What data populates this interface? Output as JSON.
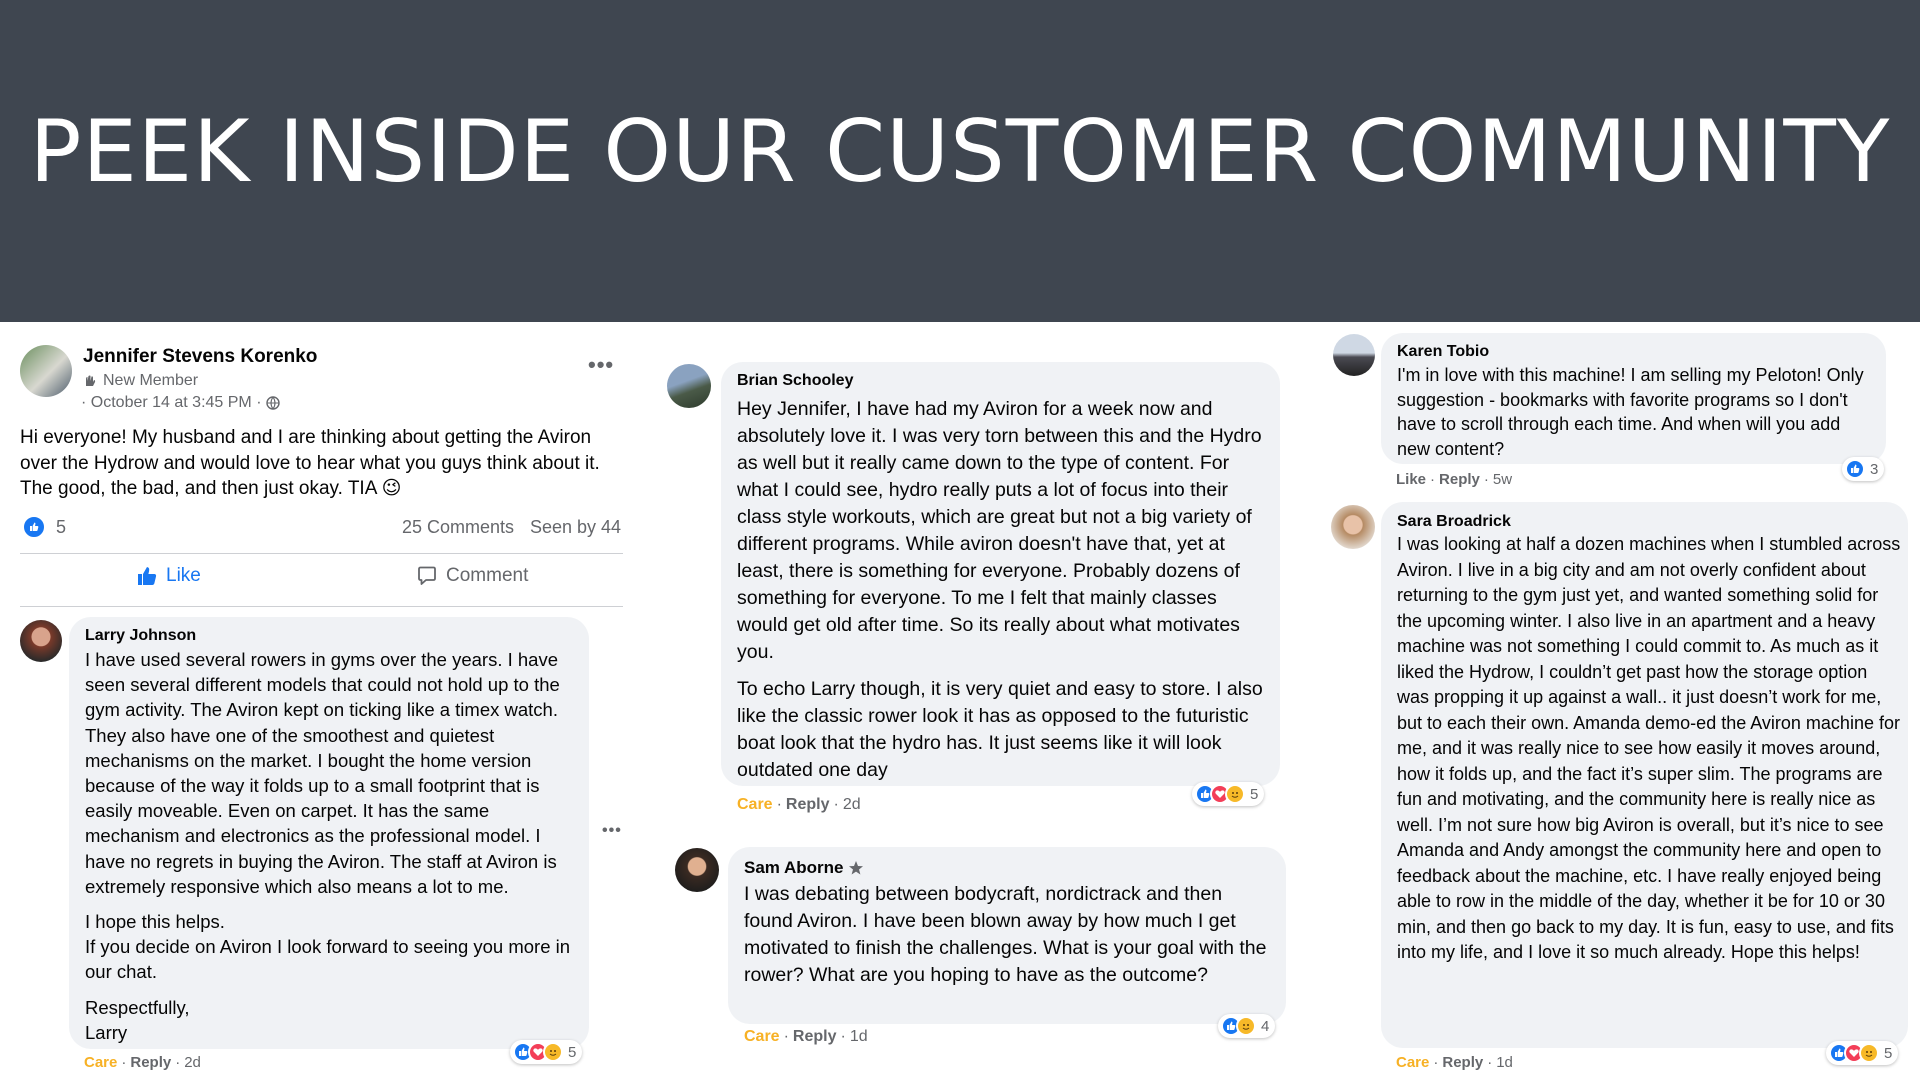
{
  "banner": {
    "title": "PEEK INSIDE OUR CUSTOMER COMMUNITY"
  },
  "post": {
    "author": "Jennifer Stevens Korenko",
    "badge": "New Member",
    "timestamp": "· October 14 at 3:45 PM ·",
    "text": "Hi everyone! My husband and I are thinking about getting the Aviron over the Hydrow and would love to hear what you guys think about it. The good, the bad, and then just okay. TIA 😉",
    "like_count": "5",
    "comments_count": "25 Comments",
    "seen_by": "Seen by 44",
    "like_label": "Like",
    "comment_label": "Comment"
  },
  "comments": {
    "larry": {
      "name": "Larry Johnson",
      "paragraphs": [
        "I have used several rowers in gyms over the years. I have seen several different models that could not hold up to the gym activity. The Aviron kept on ticking like a timex watch. They also have one of the smoothest and quietest mechanisms on the market. I bought the home version because of the way it folds up to a small footprint that is easily moveable. Even on carpet. It has the same mechanism and electronics as the professional model. I have no regrets in buying the Aviron. The staff at Aviron is extremely responsive which also means a lot to me.",
        "I hope this helps.\nIf you decide on Aviron I look forward to seeing you more in our chat.",
        "Respectfully,\nLarry"
      ],
      "care": "Care",
      "reply": "Reply",
      "age": "2d",
      "react_count": "5"
    },
    "brian": {
      "name": "Brian Schooley",
      "paragraphs": [
        "Hey Jennifer, I have had my Aviron for a week now and absolutely love it. I was very torn between this and the Hydro as well but it really came down to the type of content. For what I could see, hydro really puts a lot of focus into their class style workouts, which are great but not a big variety of different programs. While aviron doesn't have that, yet at least, there is something for everyone. Probably dozens of something for everyone. To me I felt that mainly classes would get old after time. So its really about what motivates you.",
        "To echo Larry though, it is very quiet and easy to store. I also like the classic rower look it has as opposed to the futuristic boat look that the hydro has. It just seems like it will look outdated one day"
      ],
      "care": "Care",
      "reply": "Reply",
      "age": "2d",
      "react_count": "5"
    },
    "sam": {
      "name": "Sam Aborne",
      "paragraphs": [
        "I was debating between bodycraft, nordictrack and then found Aviron. I have been blown away by how much I get motivated to finish the challenges. What is your goal with the rower? What are you hoping to have as the outcome?"
      ],
      "care": "Care",
      "reply": "Reply",
      "age": "1d",
      "react_count": "4"
    },
    "karen": {
      "name": "Karen Tobio",
      "paragraphs": [
        "I'm in love with this machine! I am selling my Peloton! Only suggestion - bookmarks with favorite programs so I don't have to scroll through each time. And when will you add new content?"
      ],
      "like": "Like",
      "reply": "Reply",
      "age": "5w",
      "react_count": "3"
    },
    "sara": {
      "name": "Sara Broadrick",
      "paragraphs": [
        "I was looking at half a dozen machines when I stumbled across Aviron. I live in a big city and am not overly confident about returning to the gym just yet, and wanted something solid for the upcoming winter. I also live in an apartment and a heavy machine was not something I could commit to. As much as it liked the Hydrow, I couldn’t get past how the storage option was propping it up against a wall.. it just doesn’t work for me, but to each their own. Amanda demo-ed the Aviron machine for me, and it was really nice to see how easily it moves around, how it folds up, and the fact it’s super slim. The programs are fun and motivating, and the community here is really nice as well. I’m not sure how big Aviron is overall, but it’s nice to see Amanda and Andy amongst the community here and open to feedback about the machine, etc. I have really enjoyed being able to row in the middle of the day, whether it be for 10 or 30 min, and then go back to my day. It is fun, easy to use, and fits into my life, and I love it so much already. Hope this helps!"
      ],
      "care": "Care",
      "reply": "Reply",
      "age": "1d",
      "react_count": "5"
    }
  },
  "colors": {
    "banner": "#3f4650",
    "bubble": "#f0f2f5",
    "like_blue": "#1877f2",
    "care_yellow": "#f7b125",
    "meta_gray": "#65676b"
  },
  "icons": [
    "more-dots-icon",
    "group-member-icon",
    "globe-icon",
    "like-thumb-icon",
    "comment-icon",
    "love-heart-icon",
    "care-face-icon",
    "star-badge-icon"
  ]
}
